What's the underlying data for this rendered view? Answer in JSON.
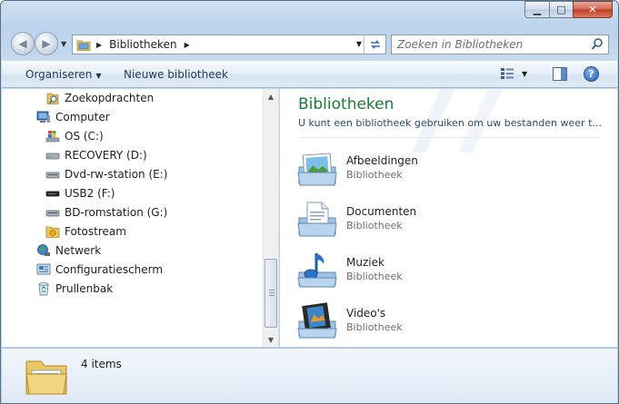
{
  "window": {
    "caption": {
      "minimize_glyph": "▁",
      "maximize_glyph": "□",
      "close_glyph": "✕"
    }
  },
  "address_bar": {
    "breadcrumb": "Bibliotheken",
    "refresh_icon": "refresh-icon"
  },
  "search": {
    "placeholder": "Zoeken in Bibliotheken"
  },
  "command_bar": {
    "organize_label": "Organiseren",
    "new_library_label": "Nieuwe bibliotheek"
  },
  "nav_tree": {
    "items": [
      {
        "label": "Zoekopdrachten",
        "icon": "saved-search-icon"
      },
      {
        "label": "Computer",
        "icon": "computer-icon"
      },
      {
        "label": "OS (C:)",
        "icon": "windows-drive-icon"
      },
      {
        "label": "RECOVERY (D:)",
        "icon": "drive-icon"
      },
      {
        "label": "Dvd-rw-station (E:)",
        "icon": "dvd-drive-icon"
      },
      {
        "label": "USB2 (F:)",
        "icon": "usb-drive-icon"
      },
      {
        "label": "BD-romstation (G:)",
        "icon": "bd-drive-icon"
      },
      {
        "label": "Fotostream",
        "icon": "photostream-icon"
      },
      {
        "label": "Netwerk",
        "icon": "network-icon"
      },
      {
        "label": "Configuratiescherm",
        "icon": "control-panel-icon"
      },
      {
        "label": "Prullenbak",
        "icon": "recycle-bin-icon"
      }
    ]
  },
  "content": {
    "title": "Bibliotheken",
    "subtitle": "U kunt een bibliotheek gebruiken om uw bestanden weer t...",
    "libraries": [
      {
        "name": "Afbeeldingen",
        "type": "Bibliotheek",
        "icon": "pictures-library-icon"
      },
      {
        "name": "Documenten",
        "type": "Bibliotheek",
        "icon": "documents-library-icon"
      },
      {
        "name": "Muziek",
        "type": "Bibliotheek",
        "icon": "music-library-icon"
      },
      {
        "name": "Video's",
        "type": "Bibliotheek",
        "icon": "videos-library-icon"
      }
    ]
  },
  "details": {
    "count": "4 items"
  },
  "colors": {
    "title_green": "#1e7a3a",
    "command_text": "#1e395b",
    "secondary_text": "#6d6d6d"
  }
}
